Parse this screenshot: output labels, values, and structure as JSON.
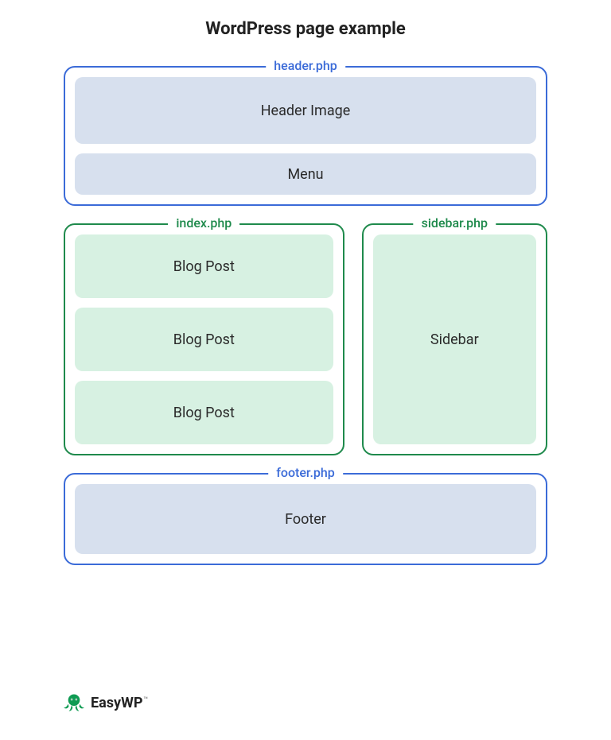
{
  "title": "WordPress page example",
  "header": {
    "file": "header.php",
    "blocks": [
      "Header Image",
      "Menu"
    ],
    "block_heights": [
      84,
      52
    ]
  },
  "index": {
    "file": "index.php",
    "blocks": [
      "Blog Post",
      "Blog Post",
      "Blog Post"
    ],
    "block_height": 80
  },
  "sidebar": {
    "file": "sidebar.php",
    "label": "Sidebar",
    "block_height": 264
  },
  "footer": {
    "file": "footer.php",
    "label": "Footer",
    "block_height": 88
  },
  "brand": {
    "name": "EasyWP",
    "tm": "™",
    "color": "#0f9b53"
  },
  "palette": {
    "blue_border": "#3b6bd8",
    "blue_fill": "#d7e0ee",
    "green_border": "#1f8a4c",
    "green_fill": "#d7f1e2"
  }
}
